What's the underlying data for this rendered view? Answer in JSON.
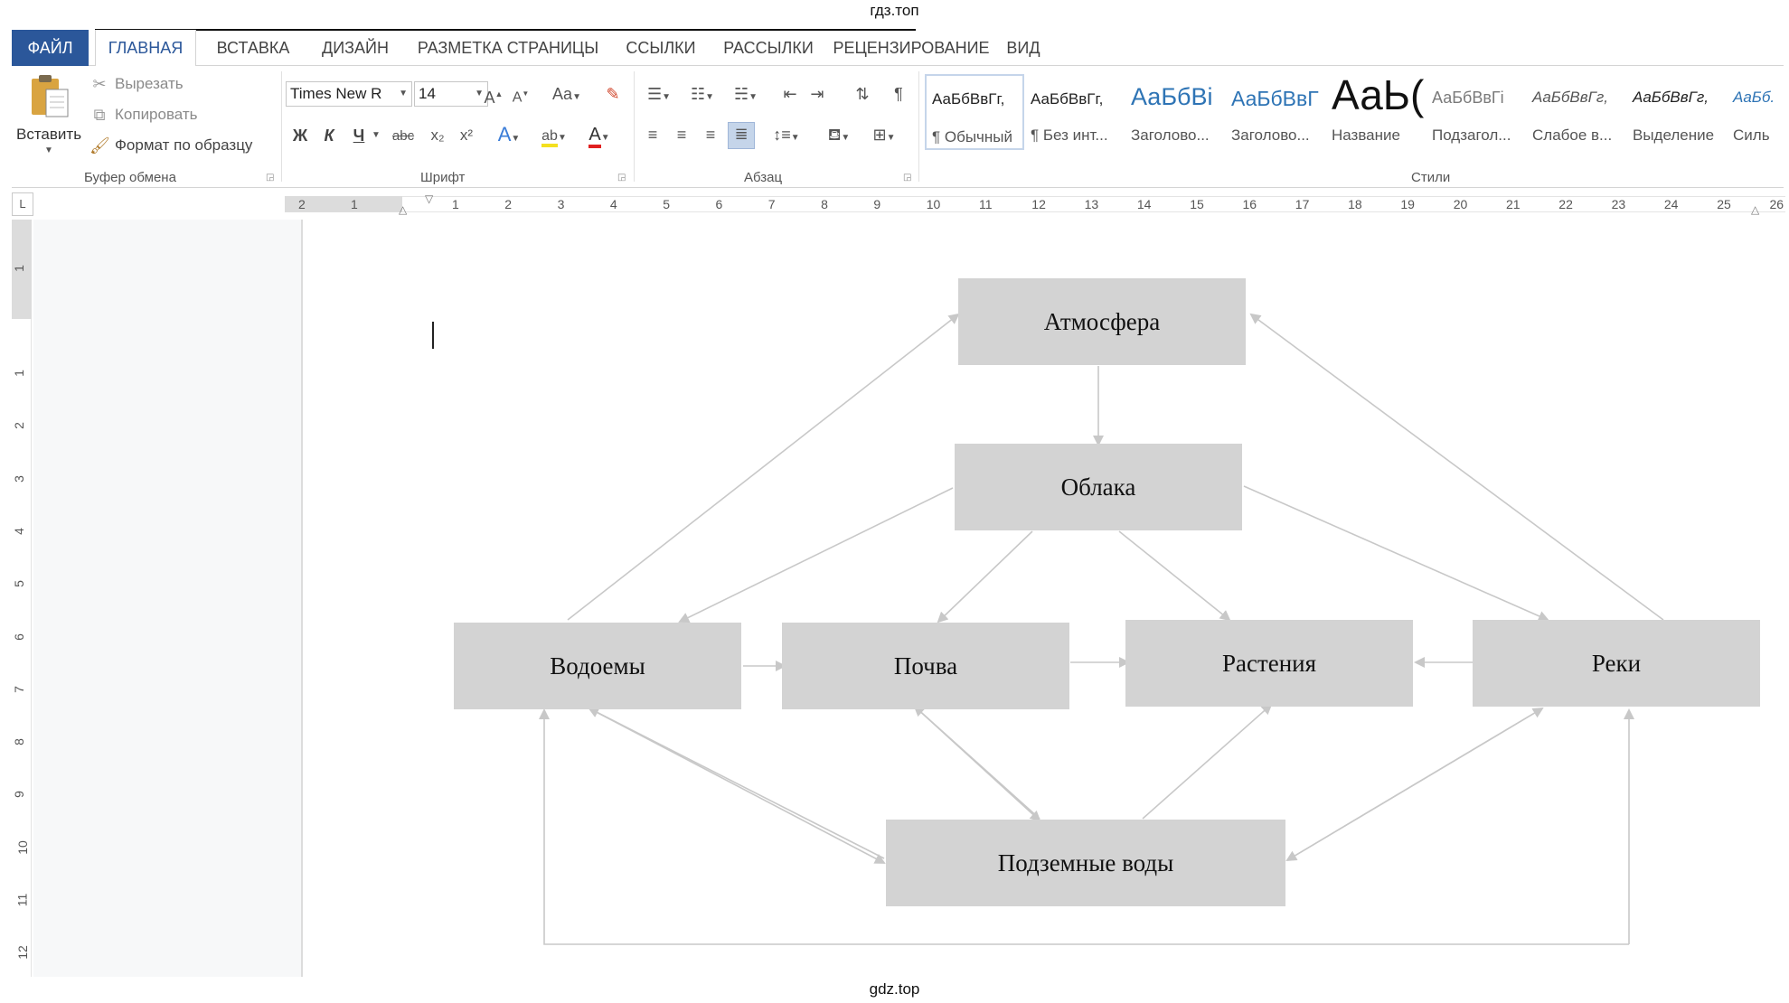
{
  "watermarks": {
    "top": "гдз.топ",
    "bottom": "gdz.top"
  },
  "tabs": {
    "file": "ФАЙЛ",
    "items": [
      "ГЛАВНАЯ",
      "ВСТАВКА",
      "ДИЗАЙН",
      "РАЗМЕТКА СТРАНИЦЫ",
      "ССЫЛКИ",
      "РАССЫЛКИ",
      "РЕЦЕНЗИРОВАНИЕ",
      "ВИД"
    ],
    "active": "ГЛАВНАЯ"
  },
  "ribbon": {
    "clipboard": {
      "paste": "Вставить",
      "cut": "Вырезать",
      "copy": "Копировать",
      "format_painter": "Формат по образцу",
      "label": "Буфер обмена"
    },
    "font": {
      "name": "Times New R",
      "size": "14",
      "bold": "Ж",
      "italic": "К",
      "underline": "Ч",
      "strike": "abc",
      "subscript": "x₂",
      "superscript": "x²",
      "grow": "A",
      "shrink": "A",
      "case": "Aa",
      "label": "Шрифт"
    },
    "paragraph": {
      "label": "Абзац",
      "pilcrow": "¶"
    },
    "styles": {
      "label": "Стили",
      "items": [
        {
          "sample": "АаБбВвГг,",
          "name": "¶ Обычный"
        },
        {
          "sample": "АаБбВвГг,",
          "name": "¶ Без инт..."
        },
        {
          "sample": "АаБбВі",
          "name": "Заголово..."
        },
        {
          "sample": "АаБбВвГ",
          "name": "Заголово..."
        },
        {
          "sample": "АаЬ(",
          "name": "Название"
        },
        {
          "sample": "АаБбВвГі",
          "name": "Подзагол..."
        },
        {
          "sample": "АаБбВвГг,",
          "name": "Слабое в..."
        },
        {
          "sample": "АаБбВвГг,",
          "name": "Выделение"
        },
        {
          "sample": "АаБб.",
          "name": "Силь"
        }
      ]
    }
  },
  "ruler": {
    "corner": "L",
    "h_labels": [
      "2",
      "1",
      "1",
      "2",
      "3",
      "4",
      "5",
      "6",
      "7",
      "8",
      "9",
      "10",
      "11",
      "12",
      "13",
      "14",
      "15",
      "16",
      "17",
      "18",
      "19",
      "20",
      "21",
      "22",
      "23",
      "24",
      "25",
      "26"
    ],
    "v_labels": [
      "1",
      "1",
      "2",
      "3",
      "4",
      "5",
      "6",
      "7",
      "8",
      "9",
      "10",
      "11",
      "12"
    ]
  },
  "diagram": {
    "nodes": {
      "atmosphere": "Атмосфера",
      "clouds": "Облака",
      "water_bodies": "Водоемы",
      "soil": "Почва",
      "plants": "Растения",
      "rivers": "Реки",
      "groundwater": "Подземные воды"
    },
    "colors": {
      "node_fill": "#d3d3d3",
      "arrow": "#c8c8c8"
    }
  }
}
